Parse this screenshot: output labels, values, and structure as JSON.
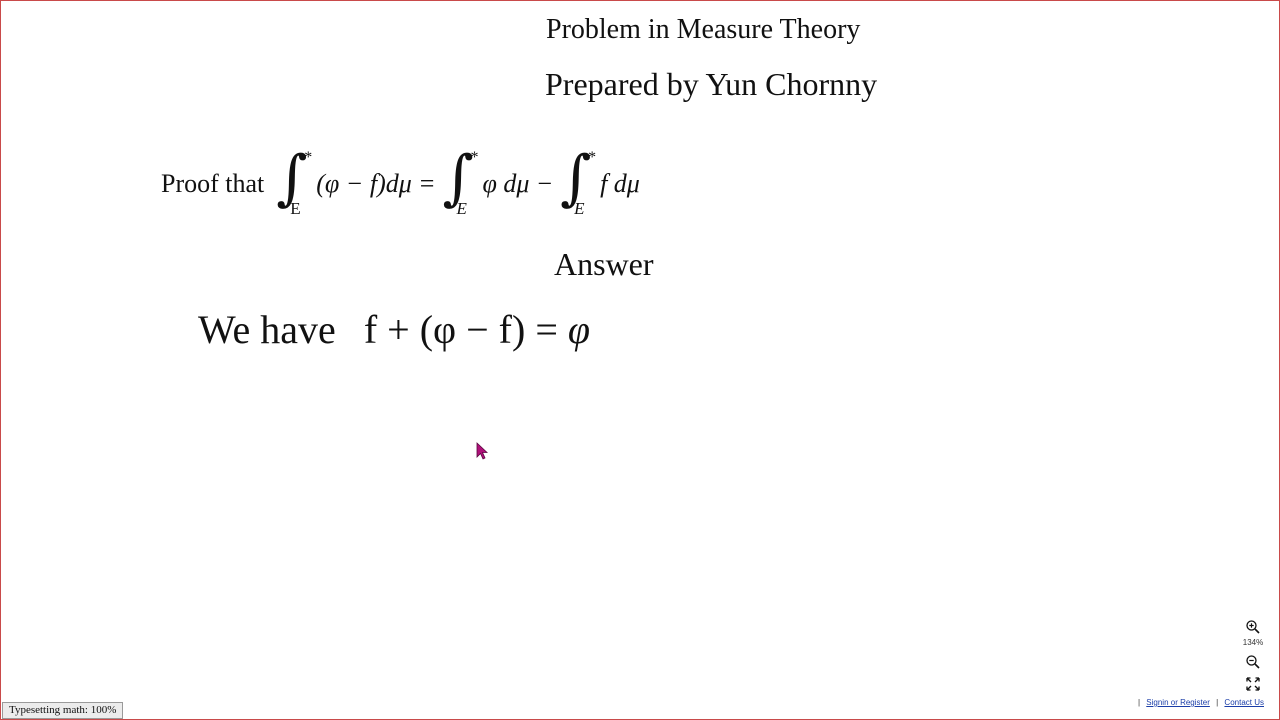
{
  "document": {
    "title": "Problem in Measure Theory",
    "author": "Prepared by Yun Chornny",
    "proof": {
      "lead": "Proof that",
      "integral_sup": "*",
      "int1_sub": "E",
      "int1_body": "(φ − f)dμ",
      "equals": "=",
      "int2_sub": "E",
      "int2_body": "φ dμ",
      "minus": "−",
      "int3_sub": "E",
      "int3_body": "f dμ"
    },
    "answer_heading": "Answer",
    "answer_line": {
      "lead": "We have",
      "lhs_f": "f",
      "plus": "+",
      "paren_expr": "(φ − f)",
      "equals": "=",
      "rhs": "φ"
    }
  },
  "zoom": {
    "level": "134%"
  },
  "footer": {
    "sep": "|",
    "signin": "Signin or Register",
    "contact": "Contact Us"
  },
  "status_bar": {
    "text": "Typesetting math: 100%"
  },
  "icons": {
    "zoom_in": "zoom-in-icon",
    "zoom_out": "zoom-out-icon",
    "fullscreen": "fullscreen-icon",
    "cursor": "mouse-cursor-icon"
  },
  "colors": {
    "frame_border": "#c94a4a",
    "link": "#1a3da8",
    "cursor": "#b0107a"
  }
}
